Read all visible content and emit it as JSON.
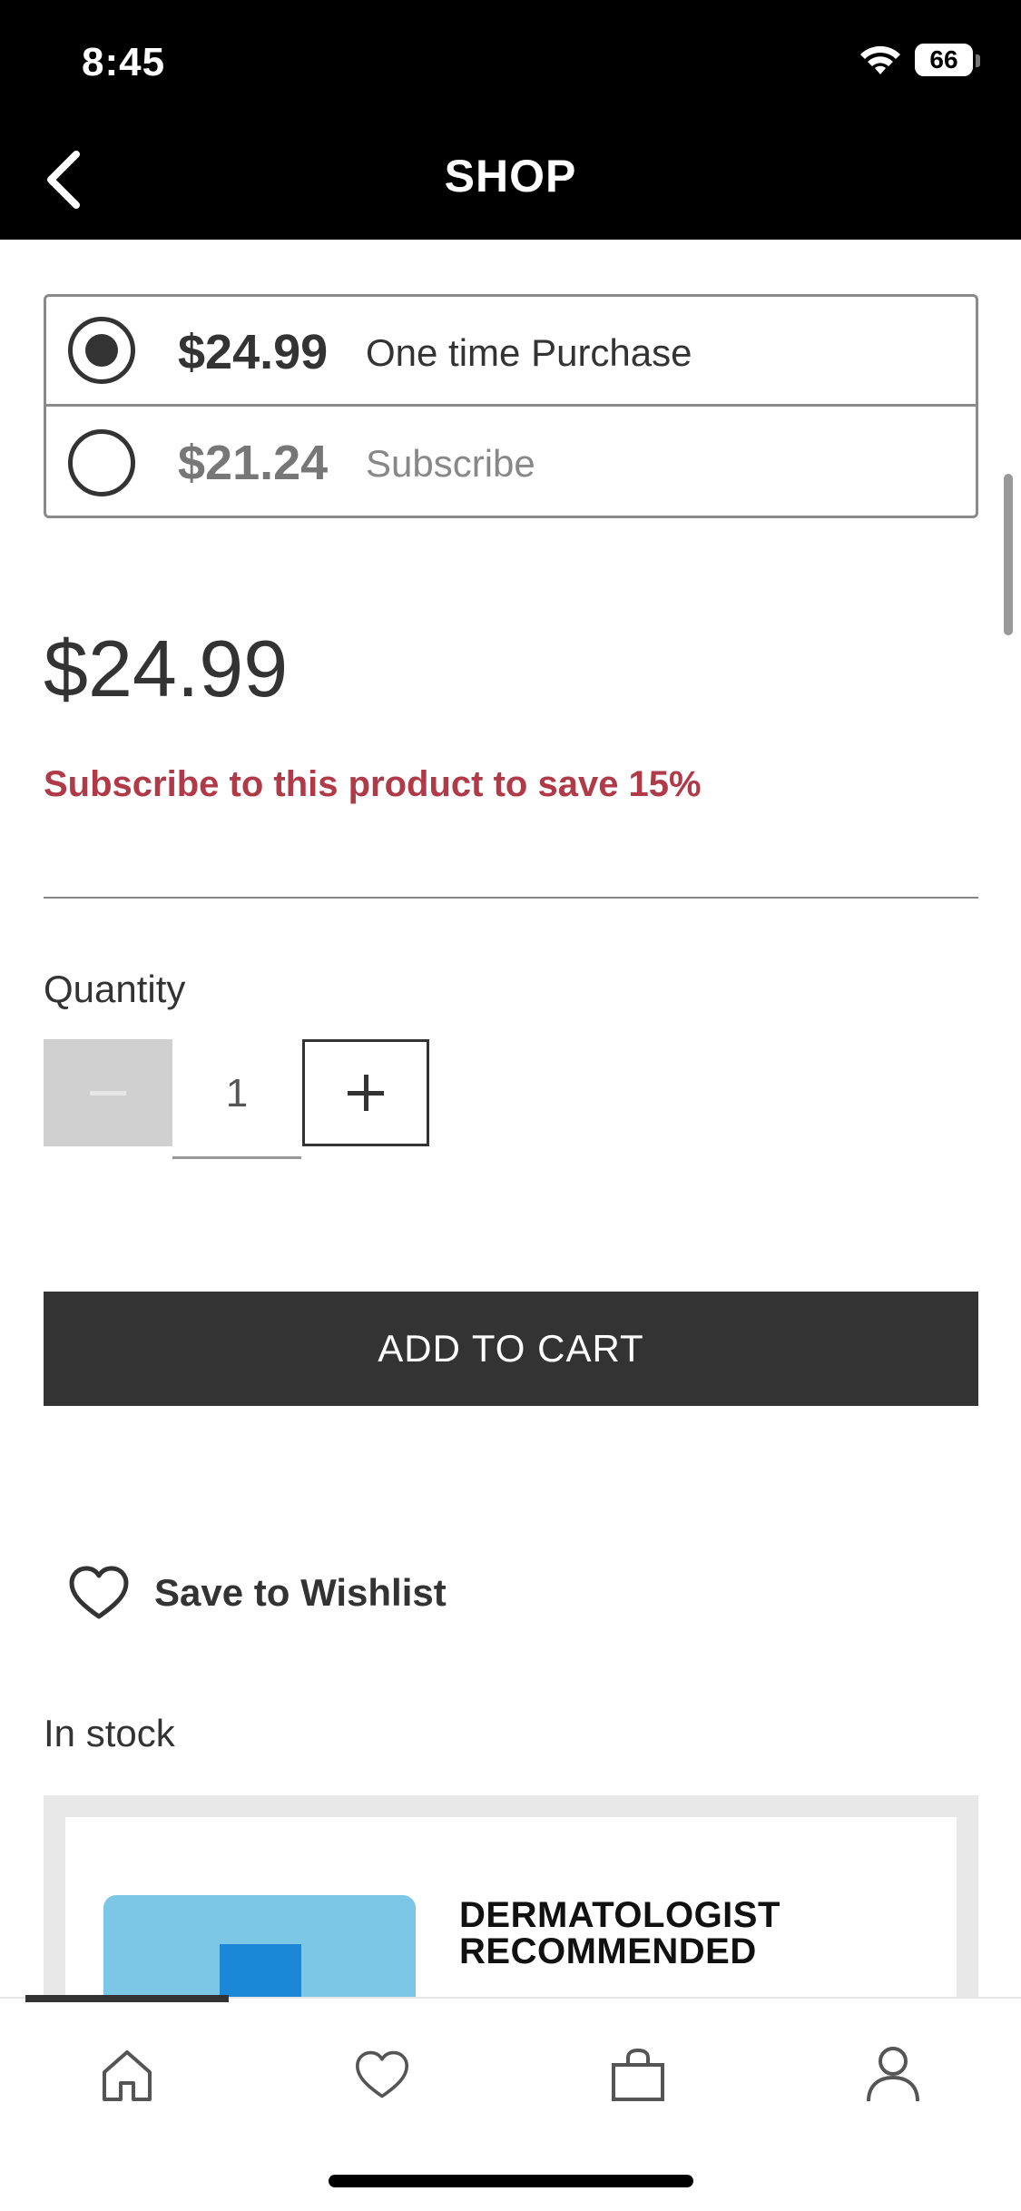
{
  "status_bar": {
    "time": "8:45",
    "battery": "66"
  },
  "header": {
    "title": "SHOP"
  },
  "purchase_options": [
    {
      "price": "$24.99",
      "label": "One time Purchase",
      "selected": true
    },
    {
      "price": "$21.24",
      "label": "Subscribe",
      "selected": false
    }
  ],
  "price": "$24.99",
  "subscribe_message": "Subscribe to this product to save 15%",
  "quantity": {
    "label": "Quantity",
    "value": "1"
  },
  "add_to_cart_label": "ADD TO CART",
  "wishlist_label": "Save to Wishlist",
  "stock_status": "In stock",
  "product_image": {
    "line1": "DERMATOLOGIST",
    "line2": "RECOMMENDED"
  },
  "bottom_nav": {
    "items": [
      "home-icon",
      "heart-icon",
      "bag-icon",
      "user-icon"
    ],
    "active": "home-icon"
  },
  "colors": {
    "accent_red": "#b03a48",
    "button_dark": "#333333",
    "header_bg": "#000000"
  }
}
